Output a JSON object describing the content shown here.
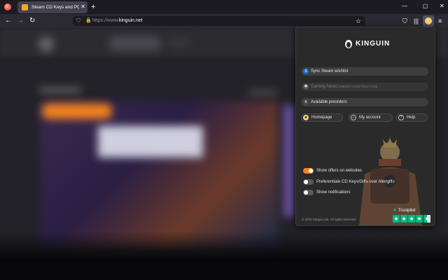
{
  "browser": {
    "tab": {
      "title": "Steam CD Keys and PC Game K",
      "close_glyph": "✕"
    },
    "new_tab_glyph": "+",
    "window_controls": [
      "—",
      "▢",
      "✕"
    ],
    "nav": {
      "back": "←",
      "forward": "→",
      "reload": "↻"
    },
    "url": {
      "scheme": "https://www.",
      "host": "kinguin.net"
    },
    "bookmark_glyph": "☆"
  },
  "popup": {
    "logo_text": "KINGUIN",
    "menu_items": [
      {
        "label": "Sync Steam wishlist",
        "icon": "steam-icon",
        "glyph": "S",
        "color": "#1b6fd8",
        "state": "enabled"
      },
      {
        "label": "Gaming News",
        "suffix": "[UNDER CONSTRUCTION]",
        "icon": "gamepad-icon",
        "glyph": "🎮",
        "color": "#666666",
        "state": "disabled"
      },
      {
        "label": "Available preorders",
        "icon": "preorder-icon",
        "glyph": "↯",
        "color": "#555555",
        "state": "enabled"
      }
    ],
    "links": [
      {
        "label": "Homepage",
        "icon": "home-mascot-icon",
        "glyph": "☻"
      },
      {
        "label": "My account",
        "icon": "user-icon",
        "glyph": "☺"
      },
      {
        "label": "Help",
        "icon": "help-icon",
        "glyph": "?"
      }
    ],
    "toggles": [
      {
        "label": "Show offers on websites",
        "on": true
      },
      {
        "label": "Preferentiate CD Keys/Gifts over Altergifts",
        "on": false
      },
      {
        "label": "Show notifications",
        "on": false
      }
    ],
    "copyright": "© 2022 Kinguin.net. All rights reserved.",
    "trustpilot": {
      "label": "Trustpilot",
      "star_glyph": "★",
      "rating_stars": 4.5,
      "accent": "#00b67a"
    },
    "accent_color": "#f58220"
  }
}
